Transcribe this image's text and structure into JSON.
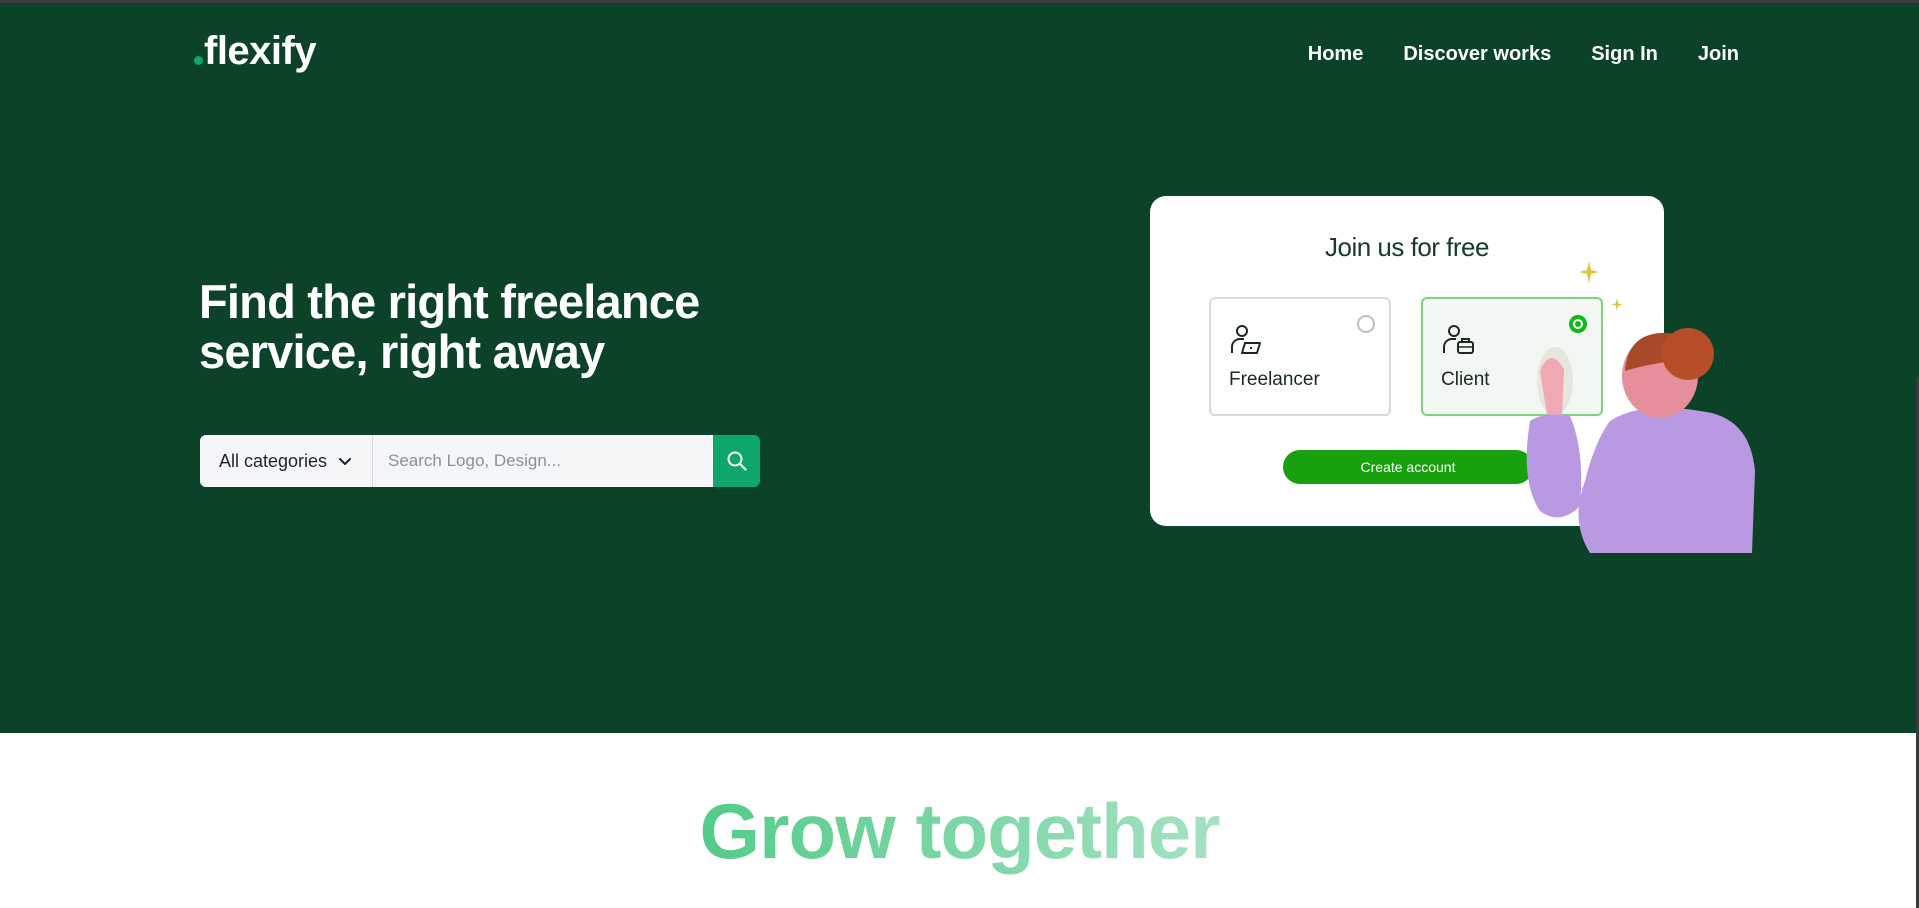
{
  "colors": {
    "hero_bg": "#0b4228",
    "accent": "#0ea66a",
    "create_button": "#17a10f",
    "radio_checked": "#12b81a",
    "grow_gradient_start": "#4fca86",
    "grow_gradient_end": "#a9e3c5"
  },
  "header": {
    "logo_text": "flexify",
    "nav": [
      {
        "label": "Home"
      },
      {
        "label": "Discover works"
      },
      {
        "label": "Sign In"
      },
      {
        "label": "Join"
      }
    ]
  },
  "hero": {
    "headline_line1": "Find the right freelance",
    "headline_line2": "service, right away",
    "search": {
      "category_label": "All categories",
      "category_icon": "chevron-down-icon",
      "placeholder": "Search Logo, Design...",
      "value": "",
      "button_icon": "search-icon"
    }
  },
  "join_card": {
    "title": "Join us for free",
    "options": [
      {
        "label": "Freelancer",
        "icon": "freelancer-laptop-icon",
        "selected": false
      },
      {
        "label": "Client",
        "icon": "client-briefcase-icon",
        "selected": true
      }
    ],
    "create_button_label": "Create account"
  },
  "section": {
    "title": "Grow together"
  }
}
